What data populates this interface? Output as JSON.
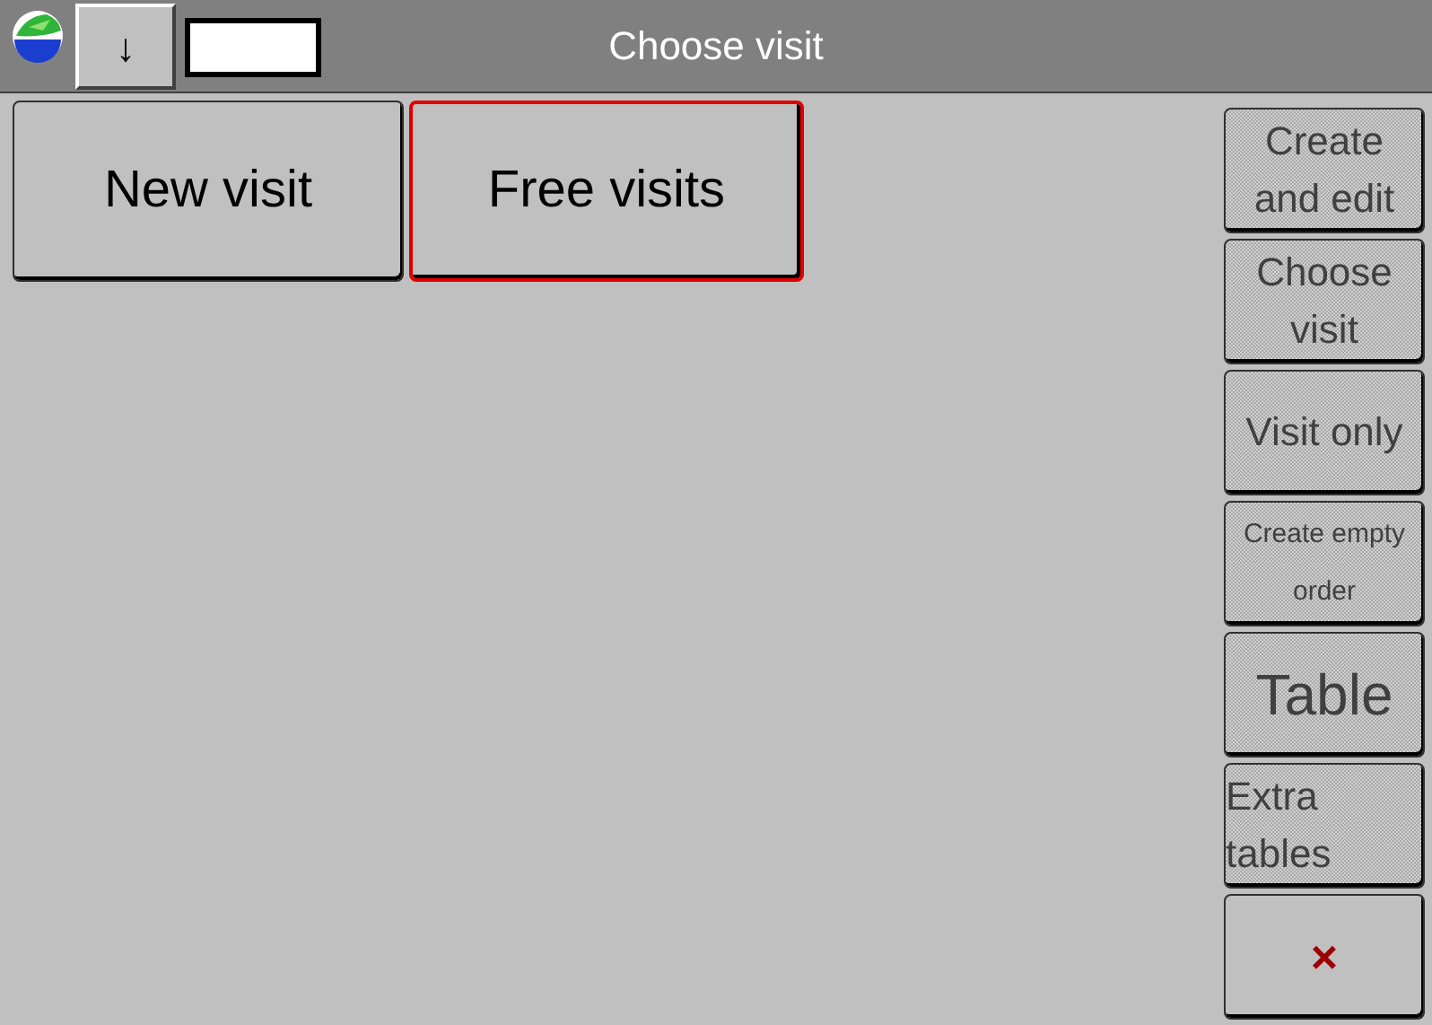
{
  "window": {
    "title": "Choose visit"
  },
  "toolbar": {
    "arrow_button": "↓"
  },
  "main_buttons": [
    {
      "label": "New visit",
      "focused": false
    },
    {
      "label": "Free visits",
      "focused": true
    }
  ],
  "side_buttons": [
    {
      "label": "Create and edit",
      "disabled": true,
      "kind": "text"
    },
    {
      "label": "Choose visit",
      "disabled": true,
      "kind": "text"
    },
    {
      "label": "Visit only",
      "disabled": true,
      "kind": "text"
    },
    {
      "label": "Create empty order",
      "disabled": true,
      "kind": "small"
    },
    {
      "label": "Table",
      "disabled": true,
      "kind": "large"
    },
    {
      "label": "Extra tables",
      "disabled": true,
      "kind": "left"
    },
    {
      "label": "×",
      "disabled": false,
      "kind": "close"
    }
  ]
}
